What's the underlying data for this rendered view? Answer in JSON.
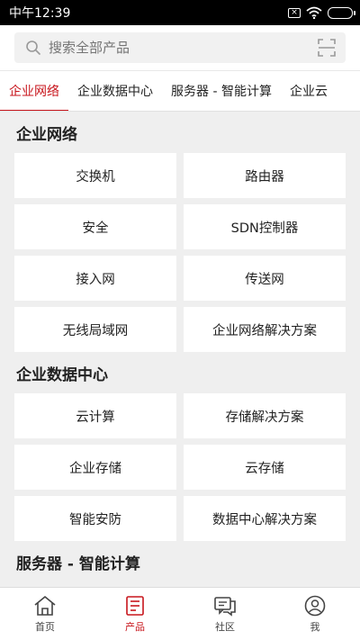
{
  "status_bar": {
    "time": "中午12:39",
    "sim_label": "×"
  },
  "search": {
    "placeholder": "搜索全部产品"
  },
  "tabs": [
    {
      "label": "企业网络"
    },
    {
      "label": "企业数据中心"
    },
    {
      "label": "服务器 - 智能计算"
    },
    {
      "label": "企业云"
    }
  ],
  "sections": [
    {
      "title": "企业网络",
      "items": [
        "交换机",
        "路由器",
        "安全",
        "SDN控制器",
        "接入网",
        "传送网",
        "无线局域网",
        "企业网络解决方案"
      ]
    },
    {
      "title": "企业数据中心",
      "items": [
        "云计算",
        "存储解决方案",
        "企业存储",
        "云存储",
        "智能安防",
        "数据中心解决方案"
      ]
    },
    {
      "title": "服务器 - 智能计算",
      "items": []
    }
  ],
  "bottom_nav": [
    {
      "label": "首页",
      "icon": "home-icon"
    },
    {
      "label": "产品",
      "icon": "product-icon"
    },
    {
      "label": "社区",
      "icon": "community-icon"
    },
    {
      "label": "我",
      "icon": "profile-icon"
    }
  ],
  "colors": {
    "accent": "#c8161d",
    "background": "#efefef"
  }
}
